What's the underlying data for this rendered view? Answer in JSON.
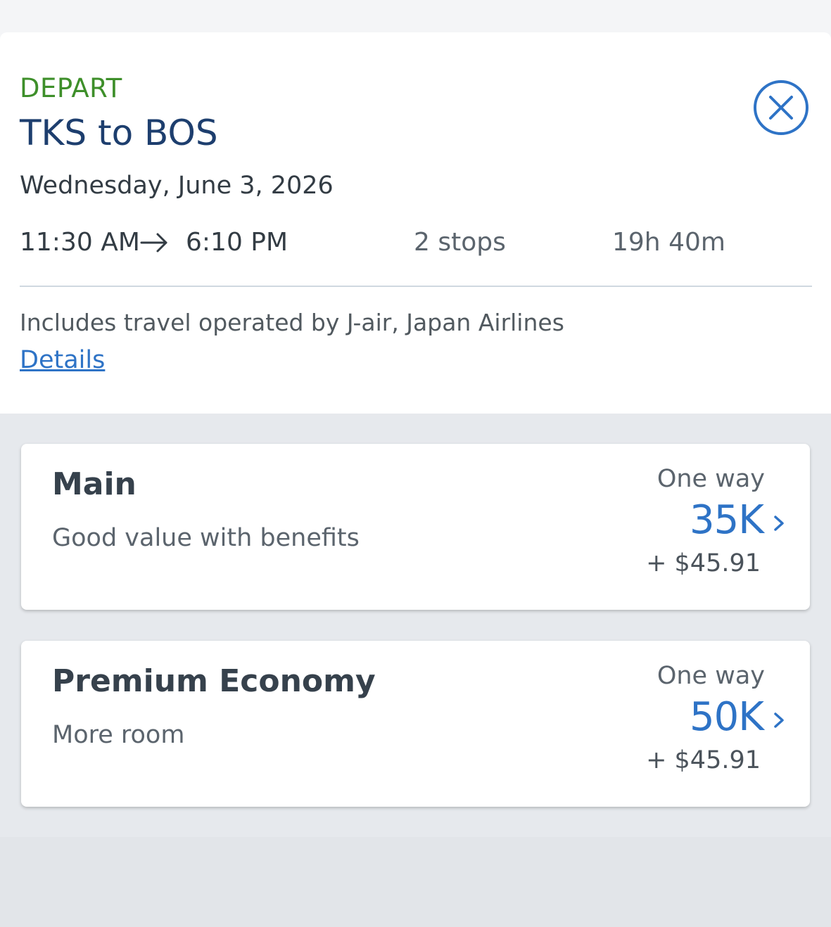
{
  "header": {
    "depart_label": "DEPART",
    "route": "TKS to BOS",
    "date": "Wednesday, June 3, 2026",
    "depart_time": "11:30 AM",
    "arrive_time": "6:10 PM",
    "stops": "2 stops",
    "duration": "19h 40m",
    "operated_by": "Includes travel operated by J-air, Japan Airlines",
    "details_link": "Details",
    "icons": {
      "close": "close-circle-icon",
      "arrow": "arrow-right-icon"
    }
  },
  "fares": [
    {
      "title": "Main",
      "subtitle": "Good value with benefits",
      "trip_type": "One way",
      "miles": "35K",
      "fee": "+ $45.91"
    },
    {
      "title": "Premium Economy",
      "subtitle": "More room",
      "trip_type": "One way",
      "miles": "50K",
      "fee": "+ $45.91"
    }
  ],
  "colors": {
    "depart_green": "#3e8f2a",
    "title_navy": "#1d3e6e",
    "link_blue": "#2e73c6",
    "background": "#e6e9ed"
  }
}
